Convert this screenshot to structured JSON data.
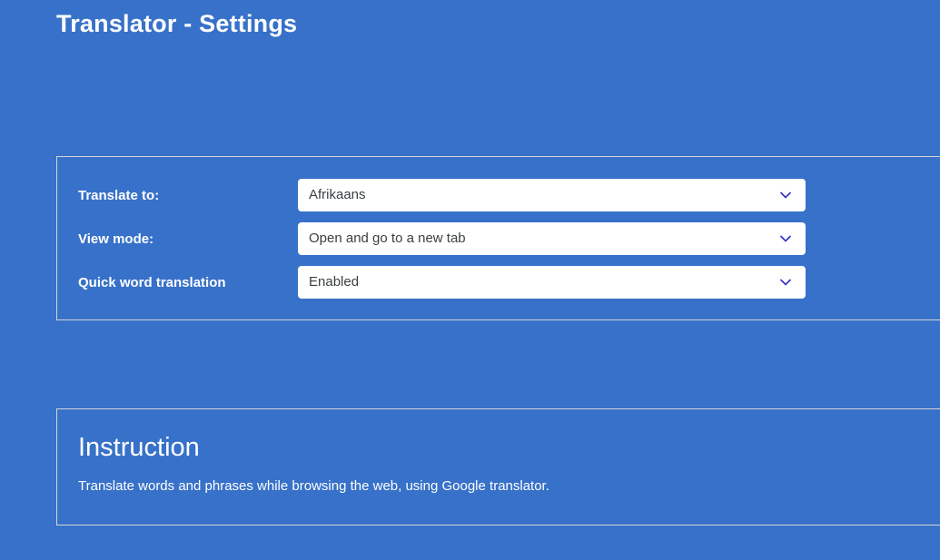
{
  "window": {
    "title": "Translator - Settings"
  },
  "settings": {
    "rows": [
      {
        "label": "Translate to:",
        "value": "Afrikaans"
      },
      {
        "label": "View mode:",
        "value": "Open and go to a new tab"
      },
      {
        "label": "Quick word translation",
        "value": "Enabled"
      }
    ]
  },
  "instruction": {
    "heading": "Instruction",
    "text": "Translate words and phrases while browsing the web, using Google translator."
  },
  "icons": {
    "dropdown_chevron": "chevron-down-icon"
  },
  "colors": {
    "background": "#3771C9",
    "card_border": "#D4D4D4",
    "title_text": "#FFFFFF",
    "select_background": "#FFFFFF",
    "select_text": "#3C4043",
    "chevron": "#2E2EC8"
  }
}
